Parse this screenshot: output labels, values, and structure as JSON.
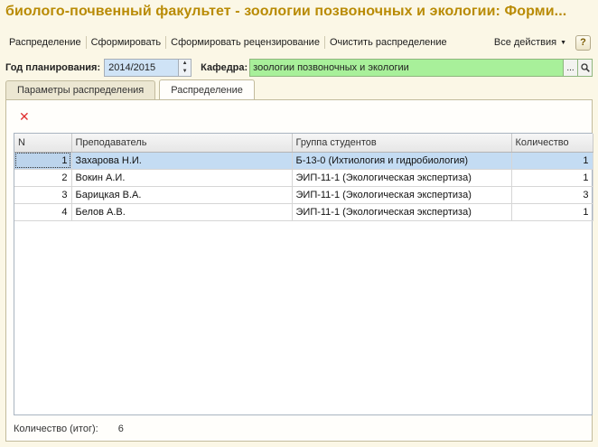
{
  "window": {
    "title": "биолого-почвенный факультет - зоологии позвоночных и экологии: Форми..."
  },
  "toolbar": {
    "items": [
      "Распределение",
      "Сформировать",
      "Сформировать рецензирование",
      "Очистить распределение"
    ],
    "all_actions": "Все действия",
    "help": "?"
  },
  "filters": {
    "year_label": "Год планирования:",
    "year_value": "2014/2015",
    "dept_label": "Кафедра:",
    "dept_value": "зоологии позвоночных и экологии",
    "dept_button": "..."
  },
  "tabs": [
    {
      "label": "Параметры распределения",
      "active": false
    },
    {
      "label": "Распределение",
      "active": true
    }
  ],
  "table": {
    "headers": [
      "N",
      "Преподаватель",
      "Группа студентов",
      "Количество"
    ],
    "rows": [
      {
        "n": "1",
        "teacher": "Захарова Н.И.",
        "group": "Б-13-0 (Ихтиология и гидробиология)",
        "count": "1"
      },
      {
        "n": "2",
        "teacher": "Вокин А.И.",
        "group": "ЭИП-11-1 (Экологическая экспертиза)",
        "count": "1"
      },
      {
        "n": "3",
        "teacher": "Барицкая В.А.",
        "group": "ЭИП-11-1 (Экологическая экспертиза)",
        "count": "3"
      },
      {
        "n": "4",
        "teacher": "Белов А.В.",
        "group": "ЭИП-11-1 (Экологическая экспертиза)",
        "count": "1"
      }
    ]
  },
  "footer": {
    "total_label": "Количество (итог):",
    "total_value": "6"
  },
  "colors": {
    "title": "#b98b05",
    "year_field": "#cfe3f6",
    "dept_field": "#a8f09a",
    "selected_row": "#c4dcf3",
    "delete_icon": "#e03030"
  }
}
